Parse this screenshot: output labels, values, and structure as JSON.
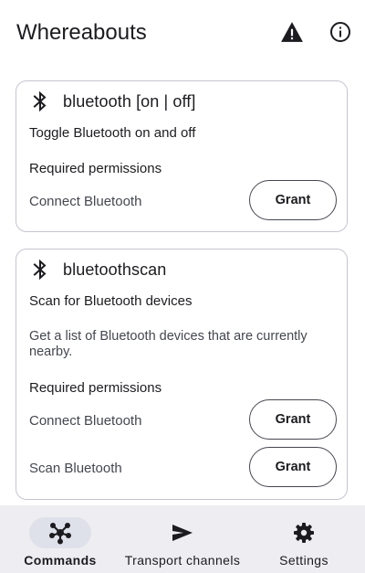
{
  "app": {
    "title": "Whereabouts"
  },
  "toolbar": {
    "warning_icon": "warning-icon",
    "info_icon": "info-icon"
  },
  "commands": [
    {
      "icon": "bluetooth-icon",
      "title": "bluetooth [on | off]",
      "subtitle": "Toggle Bluetooth on and off",
      "description": "",
      "permissions_heading": "Required permissions",
      "permissions": [
        {
          "name": "Connect Bluetooth",
          "action": "Grant"
        }
      ]
    },
    {
      "icon": "bluetooth-icon",
      "title": "bluetoothscan",
      "subtitle": "Scan for Bluetooth devices",
      "description": "Get a list of Bluetooth devices that are currently nearby.",
      "permissions_heading": "Required permissions",
      "permissions": [
        {
          "name": "Connect Bluetooth",
          "action": "Grant"
        },
        {
          "name": "Scan Bluetooth",
          "action": "Grant"
        }
      ]
    }
  ],
  "bottom_nav": {
    "active": "Commands",
    "items": [
      {
        "label": "Commands",
        "icon": "commands-hub-icon"
      },
      {
        "label": "Transport channels",
        "icon": "send-icon"
      },
      {
        "label": "Settings",
        "icon": "gear-icon"
      }
    ]
  },
  "colors": {
    "background": "#ffffff",
    "card_border": "#c4c6cf",
    "nav_background": "#eeedf1",
    "nav_active_pill": "#dfe1ea",
    "text_primary": "#1c1b1f",
    "text_secondary": "#44474e"
  }
}
